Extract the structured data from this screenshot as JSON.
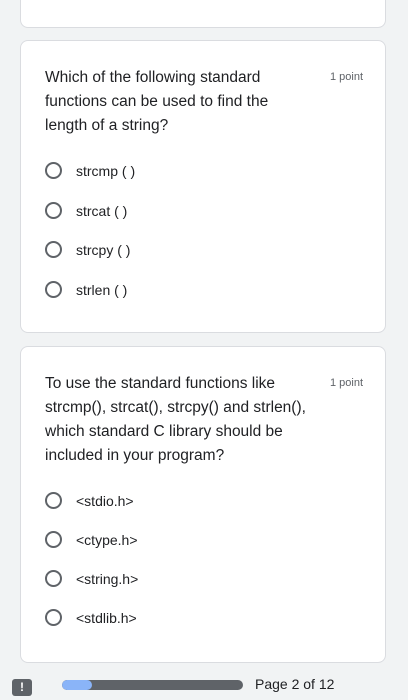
{
  "questions": [
    {
      "title": "Which of the following standard functions can be used to find the length of a string?",
      "points": "1 point",
      "options": [
        "strcmp ( )",
        "strcat ( )",
        "strcpy ( )",
        "strlen ( )"
      ]
    },
    {
      "title": "To use the standard functions like strcmp(), strcat(), strcpy() and strlen(), which standard C library should be included in your program?",
      "points": "1 point",
      "options": [
        "<stdio.h>",
        "<ctype.h>",
        "<string.h>",
        "<stdlib.h>"
      ]
    }
  ],
  "footer": {
    "report_icon": "exclamation-icon",
    "report_glyph": "!",
    "progress_fraction": 0.167,
    "page_label": "Page 2 of 12"
  },
  "colors": {
    "background": "#f1f3f4",
    "card": "#ffffff",
    "progress_fill": "#8ab4f8",
    "progress_track": "#5f6368"
  }
}
